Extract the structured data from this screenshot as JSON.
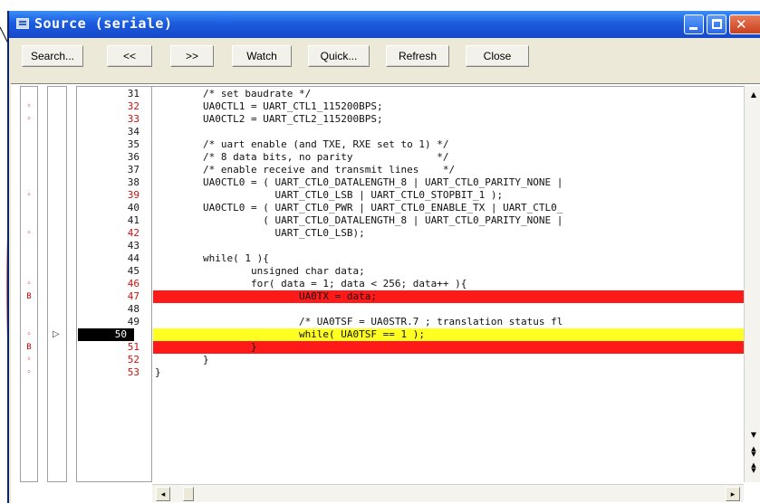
{
  "window": {
    "title": "Source (seriale)"
  },
  "toolbar": {
    "buttons": [
      {
        "label": "Search..."
      },
      {
        "label": "<<"
      },
      {
        "label": ">>"
      },
      {
        "label": "Watch"
      },
      {
        "label": "Quick..."
      },
      {
        "label": "Refresh"
      },
      {
        "label": "Close"
      }
    ]
  },
  "source": {
    "current_line": 50,
    "lines": [
      {
        "num": "31",
        "code": "        /* set baudrate */",
        "mark": "",
        "state": ""
      },
      {
        "num": "32",
        "code": "        UA0CTL1 = UART_CTL1_115200BPS;",
        "mark": "◦",
        "state": ""
      },
      {
        "num": "33",
        "code": "        UA0CTL2 = UART_CTL2_115200BPS;",
        "mark": "◦",
        "state": ""
      },
      {
        "num": "34",
        "code": "",
        "mark": "",
        "state": ""
      },
      {
        "num": "35",
        "code": "        /* uart enable (and TXE, RXE set to 1) */",
        "mark": "",
        "state": ""
      },
      {
        "num": "36",
        "code": "        /* 8 data bits, no parity              */",
        "mark": "",
        "state": ""
      },
      {
        "num": "37",
        "code": "        /* enable receive and transmit lines    */",
        "mark": "",
        "state": ""
      },
      {
        "num": "38",
        "code": "        UA0CTL0 = ( UART_CTL0_DATALENGTH_8 | UART_CTL0_PARITY_NONE |",
        "mark": "",
        "state": ""
      },
      {
        "num": "39",
        "code": "                    UART_CTL0_LSB | UART_CTL0_STOPBIT_1 );",
        "mark": "◦",
        "state": ""
      },
      {
        "num": "40",
        "code": "        UA0CTL0 = ( UART_CTL0_PWR | UART_CTL0_ENABLE_TX | UART_CTL0_",
        "mark": "",
        "state": ""
      },
      {
        "num": "41",
        "code": "                  ( UART_CTL0_DATALENGTH_8 | UART_CTL0_PARITY_NONE |",
        "mark": "",
        "state": ""
      },
      {
        "num": "42",
        "code": "                    UART_CTL0_LSB);",
        "mark": "◦",
        "state": ""
      },
      {
        "num": "43",
        "code": "",
        "mark": "",
        "state": ""
      },
      {
        "num": "44",
        "code": "        while( 1 ){",
        "mark": "",
        "state": ""
      },
      {
        "num": "45",
        "code": "                unsigned char data;",
        "mark": "",
        "state": ""
      },
      {
        "num": "46",
        "code": "                for( data = 1; data < 256; data++ ){",
        "mark": "◦",
        "state": ""
      },
      {
        "num": "47",
        "code": "                        UA0TX = data;",
        "mark": "B",
        "state": "bp"
      },
      {
        "num": "48",
        "code": "",
        "mark": "",
        "state": ""
      },
      {
        "num": "49",
        "code": "                        /* UA0TSF = UA0STR.7 ; translation status fl",
        "mark": "",
        "state": ""
      },
      {
        "num": "50",
        "code": "                        while( UA0TSF == 1 );",
        "mark": "◦",
        "state": "cur"
      },
      {
        "num": "51",
        "code": "                }",
        "mark": "B",
        "state": "bp"
      },
      {
        "num": "52",
        "code": "        }",
        "mark": "◦",
        "state": ""
      },
      {
        "num": "53",
        "code": "}",
        "mark": "◦",
        "state": ""
      }
    ]
  },
  "colors": {
    "breakpoint": "#ff1a1a",
    "current_pc": "#ffff22",
    "titlebar": "#1c5be0",
    "callout": "#e03030"
  },
  "icons": {
    "title": "window-icon",
    "minimize": "minimize-icon",
    "maximize": "maximize-icon",
    "close": "close-icon"
  }
}
